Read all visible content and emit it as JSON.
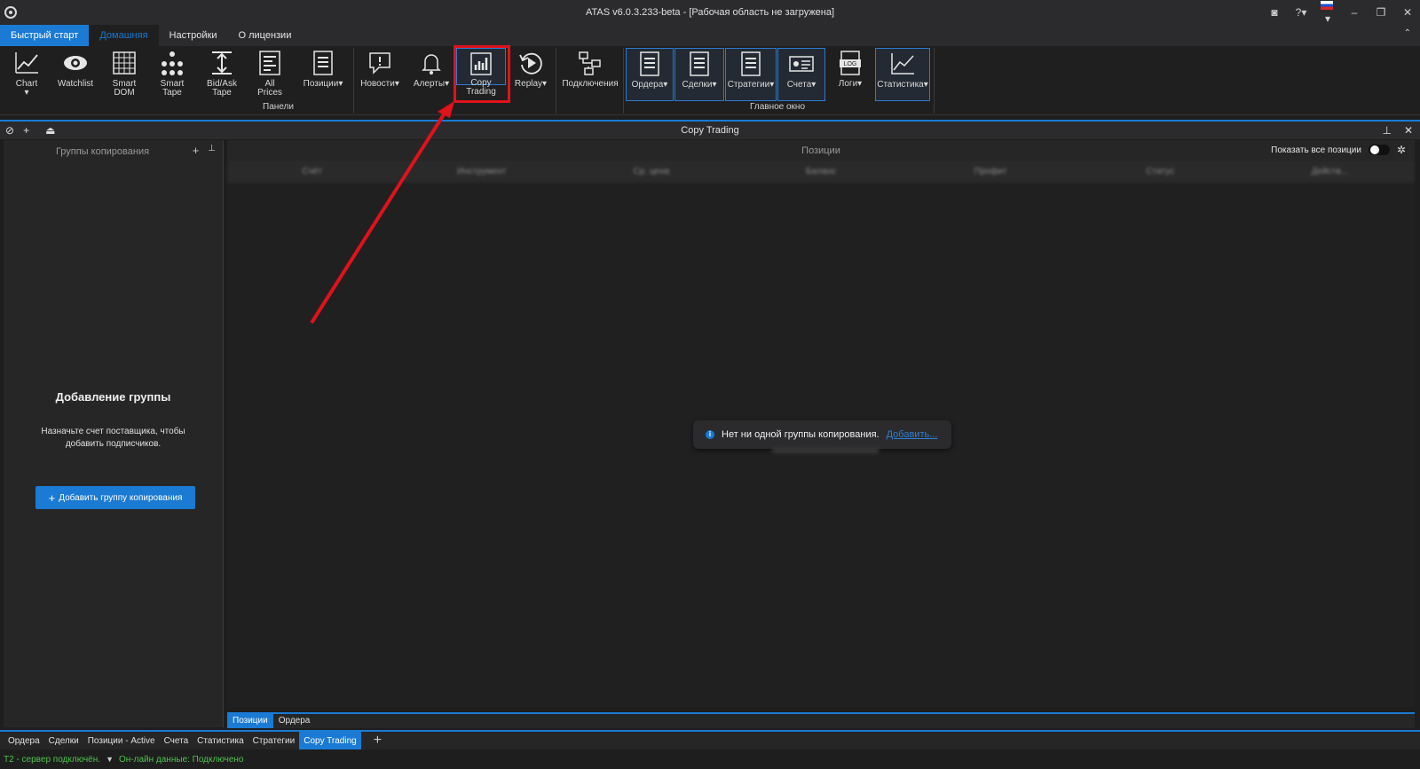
{
  "window": {
    "title": "ATAS v6.0.3.233-beta - [Рабочая область не загружена]"
  },
  "menu": {
    "tabs": [
      "Быстрый старт",
      "Домашняя",
      "Настройки",
      "О лицензии"
    ]
  },
  "ribbon": {
    "buttons": {
      "chart": "Chart",
      "watchlist": "Watchlist",
      "smart_dom": "Smart DOM",
      "smart_tape": "Smart Tape",
      "bidask_tape": "Bid/Ask Tape",
      "all_prices": "All Prices",
      "positions": "Позиции",
      "news": "Новости",
      "alerts": "Алерты",
      "copy_trading": "Copy Trading",
      "replay": "Replay",
      "connections": "Подключения",
      "orders": "Ордера",
      "trades": "Сделки",
      "strategies": "Стратегии",
      "accounts": "Счета",
      "logs": "Логи",
      "statistics": "Статистика"
    },
    "groups": {
      "panels": "Панели",
      "main_window": "Главное окно"
    }
  },
  "panel": {
    "title": "Copy Trading"
  },
  "left": {
    "title": "Группы копирования",
    "heading": "Добавление группы",
    "description": "Назначьте счет поставщика, чтобы добавить подписчиков.",
    "add_button": "Добавить группу копирования"
  },
  "right": {
    "title": "Позиции",
    "show_all": "Показать все позиции",
    "columns": [
      "Счёт",
      "Инструмент",
      "Ср. цена",
      "Баланс",
      "Профит",
      "Статус",
      "Действ..."
    ],
    "toast_text": "Нет ни одной группы копирования.",
    "toast_link": "Добавить..."
  },
  "inner_tabs": [
    "Позиции",
    "Ордера"
  ],
  "bottom_tabs": [
    "Ордера",
    "Сделки",
    "Позиции - Active",
    "Счета",
    "Статистика",
    "Стратегии",
    "Copy Trading"
  ],
  "status": {
    "server": "T2 - сервер подключён.",
    "online": "Он-лайн данные: Подключено"
  },
  "colors": {
    "accent": "#1a7ad4",
    "highlight": "#e0121b",
    "status_ok": "#4fc24f"
  }
}
